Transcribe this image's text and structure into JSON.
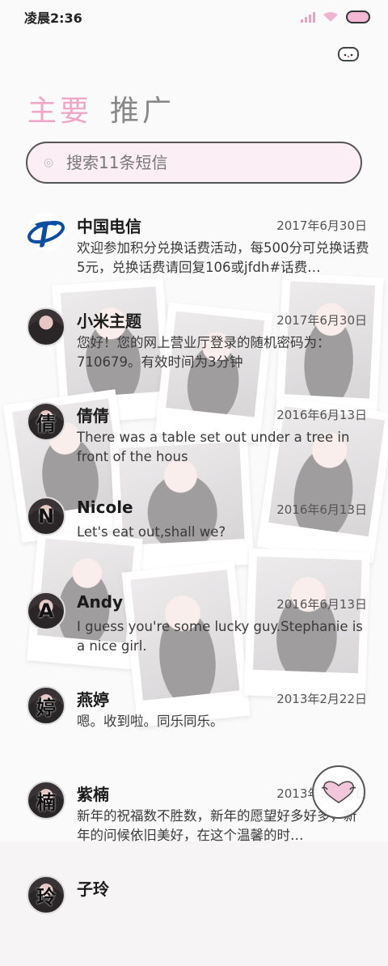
{
  "status_bar": {
    "time": "凌晨2:36"
  },
  "tabs": [
    {
      "label": "主要",
      "active": true
    },
    {
      "label": "推广",
      "active": false
    }
  ],
  "search": {
    "placeholder": "搜索11条短信"
  },
  "messages": [
    {
      "name": "中国电信",
      "date": "2017年6月30日",
      "preview": "欢迎参加积分兑换话费活动，每500分可兑换话费5元，兑换话费请回复106或jfdh#话费…",
      "avatar": "telecom-logo"
    },
    {
      "name": "小米主题",
      "date": "2017年6月30日",
      "preview": "您好！您的网上营业厅登录的随机密码为：710679。有效时间为3分钟",
      "avatar": "photo"
    },
    {
      "name": "倩倩",
      "date": "2016年6月13日",
      "preview": "There was a table set out under a tree in front of the hous",
      "avatar_initial": "倩"
    },
    {
      "name": "Nicole",
      "date": "2016年6月13日",
      "preview": "Let's eat out,shall we?",
      "avatar_initial": "N"
    },
    {
      "name": "Andy",
      "date": "2016年6月13日",
      "preview": "I guess you're some lucky guy.Stephanie is a nice girl.",
      "avatar_initial": "A"
    },
    {
      "name": "燕婷",
      "date": "2013年2月22日",
      "preview": "嗯。收到啦。同乐同乐。",
      "avatar_initial": "婷"
    },
    {
      "name": "紫楠",
      "date": "2013年2月22日",
      "preview": "新年的祝福数不胜数，新年的愿望好多好多，新年的问候依旧美好，在这个温馨的时…",
      "avatar_initial": "楠"
    },
    {
      "name": "子玲",
      "date": "",
      "preview": "",
      "avatar_initial": "玲"
    }
  ],
  "colors": {
    "accent": "#f1a7c7",
    "search_bg": "#fbeff5"
  },
  "icons": {
    "compose": "heart-mask-icon",
    "mascot": "cat-face-icon"
  }
}
